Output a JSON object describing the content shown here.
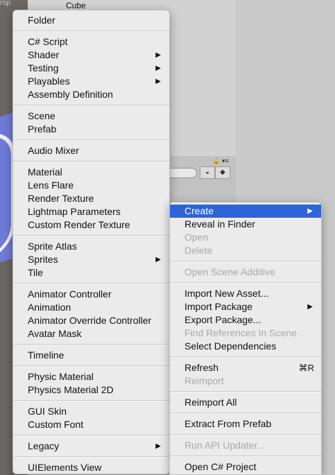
{
  "scene": {
    "view_label": "rsp"
  },
  "hierarchy": {
    "selected_object": "Cube"
  },
  "icons": {
    "lock": "lock-icon",
    "panel_menu": "panel-menu-icon",
    "filter_type": "filter-type-icon",
    "filter_label": "label-icon",
    "submenu_arrow": "submenu-arrow-icon"
  },
  "colors": {
    "highlight": "#2f64d9",
    "disabled_text": "#a9a9a9",
    "menu_bg": "#ebebeb"
  },
  "create_menu": {
    "items": [
      {
        "label": "Folder"
      },
      {
        "label": "C# Script"
      },
      {
        "label": "Shader",
        "submenu": true
      },
      {
        "label": "Testing",
        "submenu": true
      },
      {
        "label": "Playables",
        "submenu": true
      },
      {
        "label": "Assembly Definition"
      },
      {
        "label": "Scene"
      },
      {
        "label": "Prefab"
      },
      {
        "label": "Audio Mixer"
      },
      {
        "label": "Material"
      },
      {
        "label": "Lens Flare"
      },
      {
        "label": "Render Texture"
      },
      {
        "label": "Lightmap Parameters"
      },
      {
        "label": "Custom Render Texture"
      },
      {
        "label": "Sprite Atlas"
      },
      {
        "label": "Sprites",
        "submenu": true
      },
      {
        "label": "Tile"
      },
      {
        "label": "Animator Controller"
      },
      {
        "label": "Animation"
      },
      {
        "label": "Animator Override Controller"
      },
      {
        "label": "Avatar Mask"
      },
      {
        "label": "Timeline"
      },
      {
        "label": "Physic Material"
      },
      {
        "label": "Physics Material 2D"
      },
      {
        "label": "GUI Skin"
      },
      {
        "label": "Custom Font"
      },
      {
        "label": "Legacy",
        "submenu": true
      },
      {
        "label": "UIElements View"
      }
    ]
  },
  "context_menu": {
    "items": [
      {
        "label": "Create",
        "submenu": true,
        "highlighted": true
      },
      {
        "label": "Reveal in Finder"
      },
      {
        "label": "Open",
        "disabled": true
      },
      {
        "label": "Delete",
        "disabled": true
      },
      {
        "label": "Open Scene Additive",
        "disabled": true
      },
      {
        "label": "Import New Asset..."
      },
      {
        "label": "Import Package",
        "submenu": true
      },
      {
        "label": "Export Package..."
      },
      {
        "label": "Find References In Scene",
        "disabled": true
      },
      {
        "label": "Select Dependencies"
      },
      {
        "label": "Refresh",
        "shortcut": "⌘R"
      },
      {
        "label": "Reimport",
        "disabled": true
      },
      {
        "label": "Reimport All"
      },
      {
        "label": "Extract From Prefab"
      },
      {
        "label": "Run API Updater...",
        "disabled": true
      },
      {
        "label": "Open C# Project"
      }
    ]
  }
}
